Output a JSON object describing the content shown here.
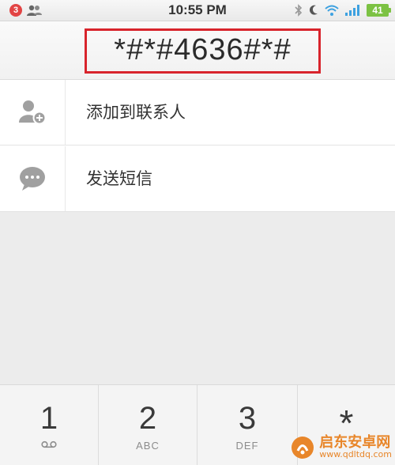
{
  "status_bar": {
    "notification_count": "3",
    "time": "10:55 PM",
    "battery_level": "41",
    "icons": [
      "contacts-icon",
      "bluetooth-icon",
      "moon-icon",
      "wifi-icon",
      "signal-icon",
      "battery-icon"
    ]
  },
  "dialer": {
    "number": "*#*#4636#*#",
    "highlight_color": "#d8242c"
  },
  "actions": [
    {
      "label": "添加到联系人",
      "icon": "add-contact-icon"
    },
    {
      "label": "发送短信",
      "icon": "message-icon"
    }
  ],
  "keypad": [
    {
      "digit": "1",
      "letters": "",
      "icon": "voicemail-icon"
    },
    {
      "digit": "2",
      "letters": "ABC"
    },
    {
      "digit": "3",
      "letters": "DEF"
    },
    {
      "digit": "*",
      "letters": ""
    }
  ],
  "watermark": {
    "title": "启东安卓网",
    "url": "www.qdltdq.com"
  }
}
